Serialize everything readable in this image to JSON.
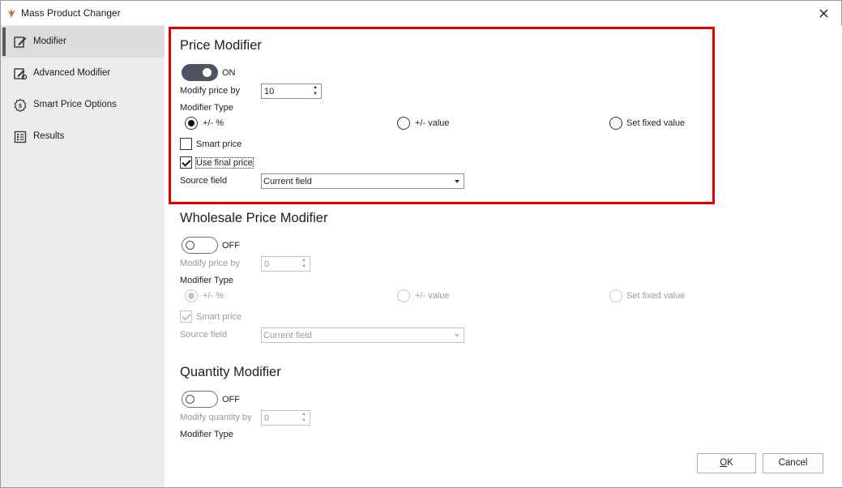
{
  "window": {
    "title": "Mass Product Changer",
    "close_symbol": "✕"
  },
  "sidebar": {
    "items": [
      {
        "label": "Modifier",
        "icon": "edit-icon",
        "active": true
      },
      {
        "label": "Advanced Modifier",
        "icon": "advanced-edit-icon",
        "active": false
      },
      {
        "label": "Smart Price Options",
        "icon": "smart-price-icon",
        "active": false
      },
      {
        "label": "Results",
        "icon": "results-list-icon",
        "active": false
      }
    ]
  },
  "price_modifier": {
    "title": "Price Modifier",
    "toggle_state": "ON",
    "modify_by_label": "Modify price by",
    "modify_by_value": "10",
    "modifier_type_label": "Modifier Type",
    "radio_options": [
      "+/- %",
      "+/- value",
      "Set fixed value"
    ],
    "selected_option": "+/- %",
    "smart_price_label": "Smart price",
    "smart_price_checked": false,
    "use_final_price_label": "Use final price",
    "use_final_price_checked": true,
    "source_field_label": "Source field",
    "source_field_value": "Current field"
  },
  "wholesale_modifier": {
    "title": "Wholesale Price Modifier",
    "toggle_state": "OFF",
    "modify_by_label": "Modify price by",
    "modify_by_value": "0",
    "modifier_type_label": "Modifier Type",
    "radio_options": [
      "+/- %",
      "+/- value",
      "Set fixed value"
    ],
    "selected_option": "+/- %",
    "smart_price_label": "Smart price",
    "smart_price_checked": true,
    "source_field_label": "Source field",
    "source_field_value": "Current field"
  },
  "quantity_modifier": {
    "title": "Quantity Modifier",
    "toggle_state": "OFF",
    "modify_by_label": "Modify quantity by",
    "modify_by_value": "0",
    "modifier_type_label": "Modifier Type"
  },
  "footer": {
    "ok_label": "OK",
    "ok_mnemonic": "O",
    "ok_rest": "K",
    "cancel_label": "Cancel"
  },
  "colors": {
    "highlight": "#e00000",
    "toggle_on": "#4e5462",
    "sidebar_bg": "#ececec",
    "sidebar_active": "#dcdcdc"
  }
}
